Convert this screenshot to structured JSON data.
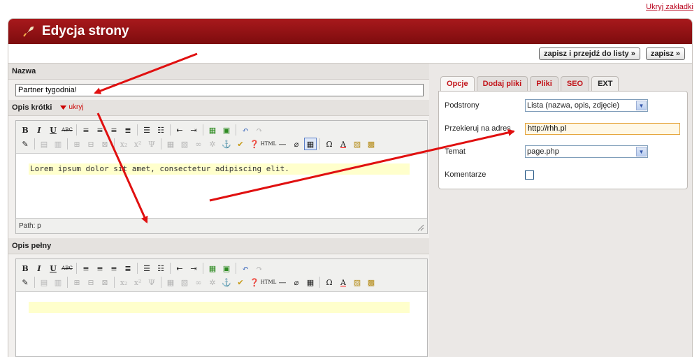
{
  "top_link": "Ukryj zakładki",
  "header": {
    "title": "Edycja strony",
    "icon": "quill-logo"
  },
  "toolbar": {
    "save_and_list": "zapisz i przejdź do listy »",
    "save": "zapisz »"
  },
  "name_section": {
    "label": "Nazwa",
    "value": "Partner tygodnia!"
  },
  "short_desc": {
    "label": "Opis krótki",
    "toggle_label": "ukryj",
    "content": "Lorem ipsum dolor sit amet, consectetur adipiscing elit.",
    "path_label": "Path: p"
  },
  "full_desc": {
    "label": "Opis pełny",
    "content": ""
  },
  "tabs": [
    {
      "label": "Opcje",
      "active": true
    },
    {
      "label": "Dodaj pliki",
      "active": false
    },
    {
      "label": "Pliki",
      "active": false
    },
    {
      "label": "SEO",
      "active": false
    },
    {
      "label": "EXT",
      "active": false
    }
  ],
  "options": {
    "subpages": {
      "label": "Podstrony",
      "value": "Lista (nazwa, opis, zdjęcie)"
    },
    "redirect": {
      "label": "Przekieruj na adres",
      "value": "http://rhh.pl"
    },
    "theme": {
      "label": "Temat",
      "value": "page.php"
    },
    "comments": {
      "label": "Komentarze",
      "checked": false
    }
  },
  "colors": {
    "header": "#8d1114",
    "tab_text": "#c2141a",
    "arrow": "#e01010",
    "highlight": "#ffffcc"
  }
}
